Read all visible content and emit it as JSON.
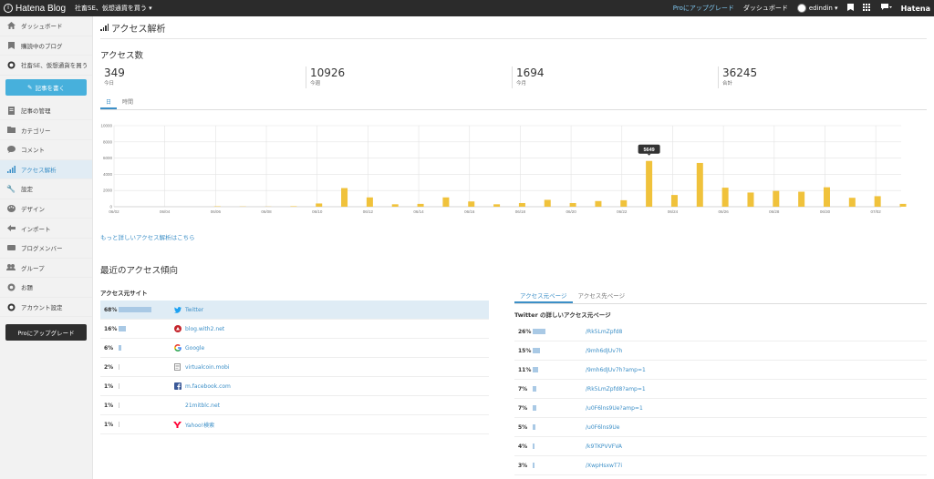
{
  "topbar": {
    "logo_text": "Hatena Blog",
    "blog_name": "社畜SE、仮想通貨を買う ▾",
    "pro_link": "Proにアップグレード",
    "dashboard": "ダッシュボード",
    "username": "edindin ▾",
    "hatena": "Hatena"
  },
  "sidebar": {
    "items": [
      {
        "label": "ダッシュボード",
        "icon": "home-icon"
      },
      {
        "label": "購読中のブログ",
        "icon": "bookmark-icon"
      },
      {
        "label": "社畜SE、仮想通貨を買う",
        "icon": "blog-icon"
      }
    ],
    "write_button": "記事を書く",
    "menu": [
      {
        "label": "記事の管理",
        "icon": "document-icon"
      },
      {
        "label": "カテゴリー",
        "icon": "folder-icon"
      },
      {
        "label": "コメント",
        "icon": "comment-icon"
      },
      {
        "label": "アクセス解析",
        "icon": "analytics-icon",
        "active": true
      },
      {
        "label": "設定",
        "icon": "wrench-icon"
      },
      {
        "label": "デザイン",
        "icon": "palette-icon"
      },
      {
        "label": "インポート",
        "icon": "import-icon"
      },
      {
        "label": "ブログメンバー",
        "icon": "members-icon"
      },
      {
        "label": "グループ",
        "icon": "group-icon"
      },
      {
        "label": "お題",
        "icon": "topic-icon"
      },
      {
        "label": "アカウント設定",
        "icon": "account-icon"
      }
    ],
    "pro_button": "Proにアップグレード"
  },
  "main": {
    "title": "アクセス解析",
    "access_count_title": "アクセス数",
    "stats": [
      {
        "value": "349",
        "label": "今日"
      },
      {
        "value": "10926",
        "label": "今週"
      },
      {
        "value": "1694",
        "label": "今月"
      },
      {
        "value": "36245",
        "label": "合計"
      }
    ],
    "tabs": [
      "日",
      "時間"
    ],
    "more_link": "もっと詳しいアクセス解析はこちら",
    "trend_title": "最近のアクセス傾向"
  },
  "chart_data": {
    "type": "bar",
    "ylim": [
      0,
      10000
    ],
    "yticks": [
      "10000",
      "8000",
      "6000",
      "4000",
      "2000",
      "0"
    ],
    "xticks": [
      "06/02",
      "06/04",
      "06/06",
      "06/08",
      "06/10",
      "06/12",
      "06/14",
      "06/16",
      "06/18",
      "06/20",
      "06/22",
      "06/24",
      "06/26",
      "06/28",
      "06/30",
      "07/02"
    ],
    "values": [
      0,
      0,
      0,
      0,
      50,
      30,
      20,
      60,
      400,
      2300,
      1150,
      300,
      350,
      1150,
      650,
      300,
      450,
      850,
      450,
      700,
      800,
      5649,
      1450,
      5400,
      2350,
      1750,
      1950,
      1850,
      2400,
      1100,
      1300,
      350
    ],
    "tooltip": "5649",
    "color": "#f0c23b",
    "grid": true
  },
  "sites": {
    "title": "アクセス元サイト",
    "rows": [
      {
        "pct": "68%",
        "share": 68,
        "name": "Twitter",
        "icon": "twitter-icon",
        "highlight": true
      },
      {
        "pct": "16%",
        "share": 16,
        "name": "blog.with2.net",
        "icon": "blogranking-icon"
      },
      {
        "pct": "6%",
        "share": 6,
        "name": "Google",
        "icon": "google-icon"
      },
      {
        "pct": "2%",
        "share": 2,
        "name": "virtualcoin.mobi",
        "icon": "page-icon"
      },
      {
        "pct": "1%",
        "share": 1,
        "name": "m.facebook.com",
        "icon": "facebook-icon"
      },
      {
        "pct": "1%",
        "share": 1,
        "name": "21mitblc.net",
        "icon": ""
      },
      {
        "pct": "1%",
        "share": 1,
        "name": "Yahoo!検索",
        "icon": "yahoo-icon"
      }
    ]
  },
  "pages": {
    "tabs": [
      "アクセス元ページ",
      "アクセス先ページ"
    ],
    "subtitle": "Twitter の詳しいアクセス元ページ",
    "rows": [
      {
        "pct": "26%",
        "share": 26,
        "path": "/Rk5LmZpfd8"
      },
      {
        "pct": "15%",
        "share": 15,
        "path": "/9mh6dJUv7h"
      },
      {
        "pct": "11%",
        "share": 11,
        "path": "/9mh6dJUv7h?amp=1"
      },
      {
        "pct": "7%",
        "share": 7,
        "path": "/Rk5LmZpfd8?amp=1"
      },
      {
        "pct": "7%",
        "share": 7,
        "path": "/u0F6lns9Ue?amp=1"
      },
      {
        "pct": "5%",
        "share": 5,
        "path": "/u0F6lns9Ue"
      },
      {
        "pct": "4%",
        "share": 4,
        "path": "/k9TKPVVFVA"
      },
      {
        "pct": "3%",
        "share": 3,
        "path": "/XwpHsxwT7i"
      }
    ]
  }
}
